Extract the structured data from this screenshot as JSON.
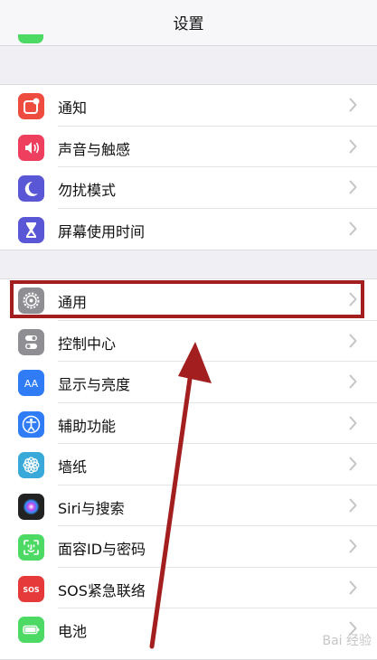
{
  "nav": {
    "title": "设置"
  },
  "groups": [
    {
      "items": [
        {
          "label": "通知",
          "icon": "notifications-icon",
          "color": "#ef4c40"
        },
        {
          "label": "声音与触感",
          "icon": "sounds-icon",
          "color": "#ee3f5f"
        },
        {
          "label": "勿扰模式",
          "icon": "do-not-disturb-icon",
          "color": "#5a57d6"
        },
        {
          "label": "屏幕使用时间",
          "icon": "screen-time-icon",
          "color": "#5a57d6"
        }
      ]
    },
    {
      "items": [
        {
          "label": "通用",
          "icon": "general-gear-icon",
          "color": "#8e8e93"
        },
        {
          "label": "控制中心",
          "icon": "control-center-icon",
          "color": "#8e8e93"
        },
        {
          "label": "显示与亮度",
          "icon": "display-brightness-icon",
          "color": "#2f7cf6",
          "icon_text": "AA"
        },
        {
          "label": "辅助功能",
          "icon": "accessibility-icon",
          "color": "#2f7cf6"
        },
        {
          "label": "墙纸",
          "icon": "wallpaper-icon",
          "color": "#38a9d8"
        },
        {
          "label": "Siri与搜索",
          "icon": "siri-icon",
          "color": "#222222"
        },
        {
          "label": "面容ID与密码",
          "icon": "face-id-icon",
          "color": "#4cd964"
        },
        {
          "label": "SOS紧急联络",
          "icon": "sos-icon",
          "color": "#e5393a",
          "icon_text": "SOS"
        },
        {
          "label": "电池",
          "icon": "battery-icon",
          "color": "#4cd964"
        }
      ]
    }
  ],
  "annotation": {
    "color": "#a31f1f"
  },
  "watermark": "Bai 经验"
}
